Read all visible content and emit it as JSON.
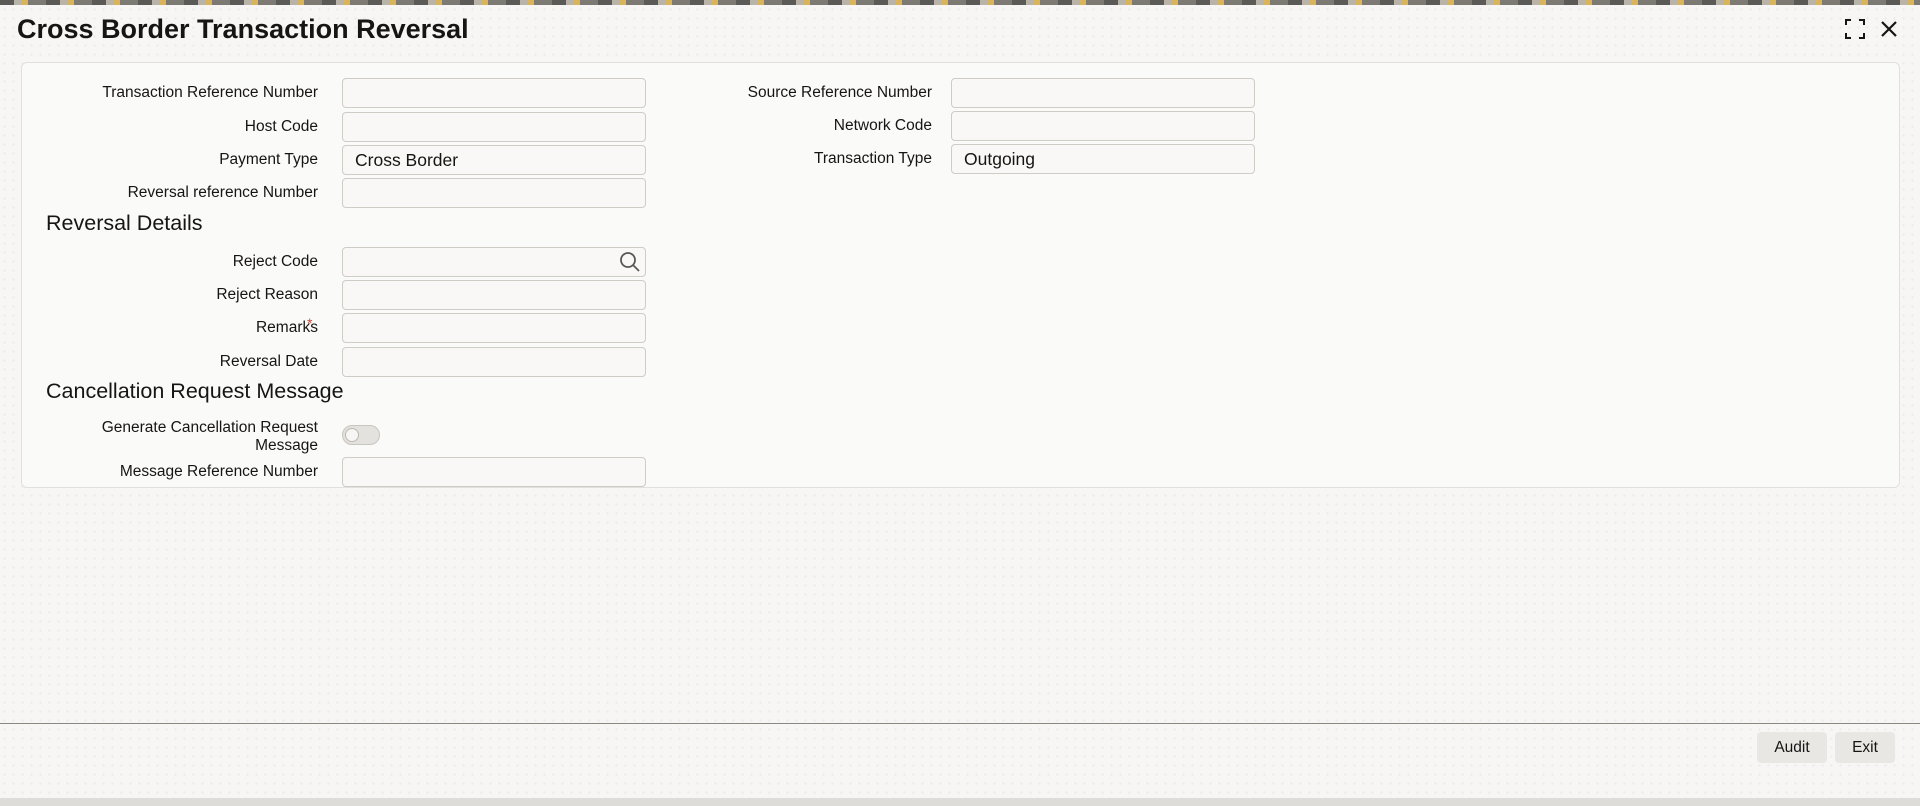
{
  "window": {
    "title": "Cross Border Transaction Reversal"
  },
  "form": {
    "transaction_reference_number": {
      "label": "Transaction Reference Number",
      "value": ""
    },
    "host_code": {
      "label": "Host Code",
      "value": ""
    },
    "payment_type": {
      "label": "Payment Type",
      "value": "Cross Border"
    },
    "reversal_reference_number": {
      "label": "Reversal reference Number",
      "value": ""
    },
    "source_reference_number": {
      "label": "Source Reference Number",
      "value": ""
    },
    "network_code": {
      "label": "Network Code",
      "value": ""
    },
    "transaction_type": {
      "label": "Transaction Type",
      "value": "Outgoing"
    }
  },
  "reversal_details": {
    "heading": "Reversal Details",
    "reject_code": {
      "label": "Reject Code",
      "value": ""
    },
    "reject_reason": {
      "label": "Reject Reason",
      "value": ""
    },
    "remarks": {
      "label": "Remarks",
      "required_mark": "*",
      "value": ""
    },
    "reversal_date": {
      "label": "Reversal Date",
      "value": ""
    }
  },
  "cancellation": {
    "heading": "Cancellation Request Message",
    "generate_toggle": {
      "label_line1": "Generate Cancellation Request",
      "label_line2": "Message",
      "checked": false
    },
    "message_reference_number": {
      "label": "Message Reference Number",
      "value": ""
    }
  },
  "footer": {
    "audit_label": "Audit",
    "exit_label": "Exit"
  },
  "icons": {
    "maximize": "maximize-icon",
    "close": "close-icon",
    "search": "search-icon"
  },
  "colors": {
    "background": "#f7f6f4",
    "panel": "#fafaf9",
    "text": "#161513",
    "required": "#c74634"
  }
}
